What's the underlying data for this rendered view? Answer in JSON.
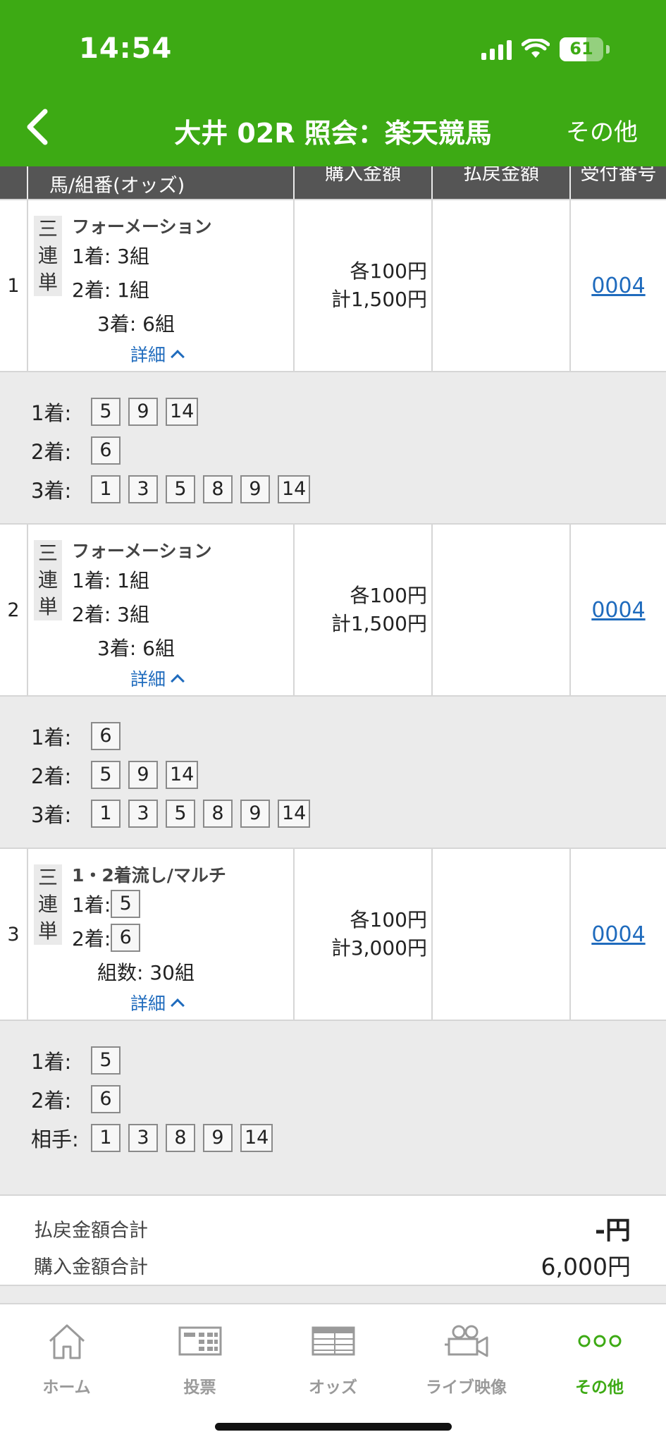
{
  "status": {
    "time": "14:54",
    "battery": "61",
    "battery_level": 0.61
  },
  "nav": {
    "title": "大井 02R 照会：楽天競馬",
    "more": "その他"
  },
  "table_header": {
    "horse": "馬/組番(オッズ)",
    "amount": "購入金額",
    "payout": "払戻金額",
    "receipt": "受付番号"
  },
  "rows": [
    {
      "index": "1",
      "bet_type": [
        "三",
        "連",
        "単"
      ],
      "method": "フォーメーション",
      "lines": [
        "1着: 3組",
        "2着: 1組",
        "3着: 6組"
      ],
      "detail": "詳細",
      "amount_each": "各100円",
      "amount_total": "計1,500円",
      "receipt": "0004",
      "expand": [
        {
          "label": "1着:",
          "numbers": [
            "5",
            "9",
            "14"
          ]
        },
        {
          "label": "2着:",
          "numbers": [
            "6"
          ]
        },
        {
          "label": "3着:",
          "numbers": [
            "1",
            "3",
            "5",
            "8",
            "9",
            "14"
          ]
        }
      ]
    },
    {
      "index": "2",
      "bet_type": [
        "三",
        "連",
        "単"
      ],
      "method": "フォーメーション",
      "lines": [
        "1着: 1組",
        "2着: 3組",
        "3着: 6組"
      ],
      "detail": "詳細",
      "amount_each": "各100円",
      "amount_total": "計1,500円",
      "receipt": "0004",
      "expand": [
        {
          "label": "1着:",
          "numbers": [
            "6"
          ]
        },
        {
          "label": "2着:",
          "numbers": [
            "5",
            "9",
            "14"
          ]
        },
        {
          "label": "3着:",
          "numbers": [
            "1",
            "3",
            "5",
            "8",
            "9",
            "14"
          ]
        }
      ]
    },
    {
      "index": "3",
      "bet_type": [
        "三",
        "連",
        "単"
      ],
      "method": "1・2着流し/マルチ",
      "line1_label": "1着:",
      "line1_num": "5",
      "line2_label": "2着:",
      "line2_num": "6",
      "combos": "組数: 30組",
      "detail": "詳細",
      "amount_each": "各100円",
      "amount_total": "計3,000円",
      "receipt": "0004",
      "expand": [
        {
          "label": "1着:",
          "numbers": [
            "5"
          ]
        },
        {
          "label": "2着:",
          "numbers": [
            "6"
          ]
        },
        {
          "label": "相手:",
          "numbers": [
            "1",
            "3",
            "8",
            "9",
            "14"
          ]
        }
      ]
    }
  ],
  "summary": {
    "payout_label": "払戻金額合計",
    "payout_value": "-円",
    "purchase_label": "購入金額合計",
    "purchase_value": "6,000円"
  },
  "tabs": [
    {
      "label": "ホーム",
      "icon": "home-icon"
    },
    {
      "label": "投票",
      "icon": "ticket-icon"
    },
    {
      "label": "オッズ",
      "icon": "odds-table-icon"
    },
    {
      "label": "ライブ映像",
      "icon": "video-camera-icon"
    },
    {
      "label": "その他",
      "icon": "more-dots-icon",
      "active": true
    }
  ],
  "colors": {
    "brand": "#3daa14",
    "link": "#1f6bbd"
  }
}
